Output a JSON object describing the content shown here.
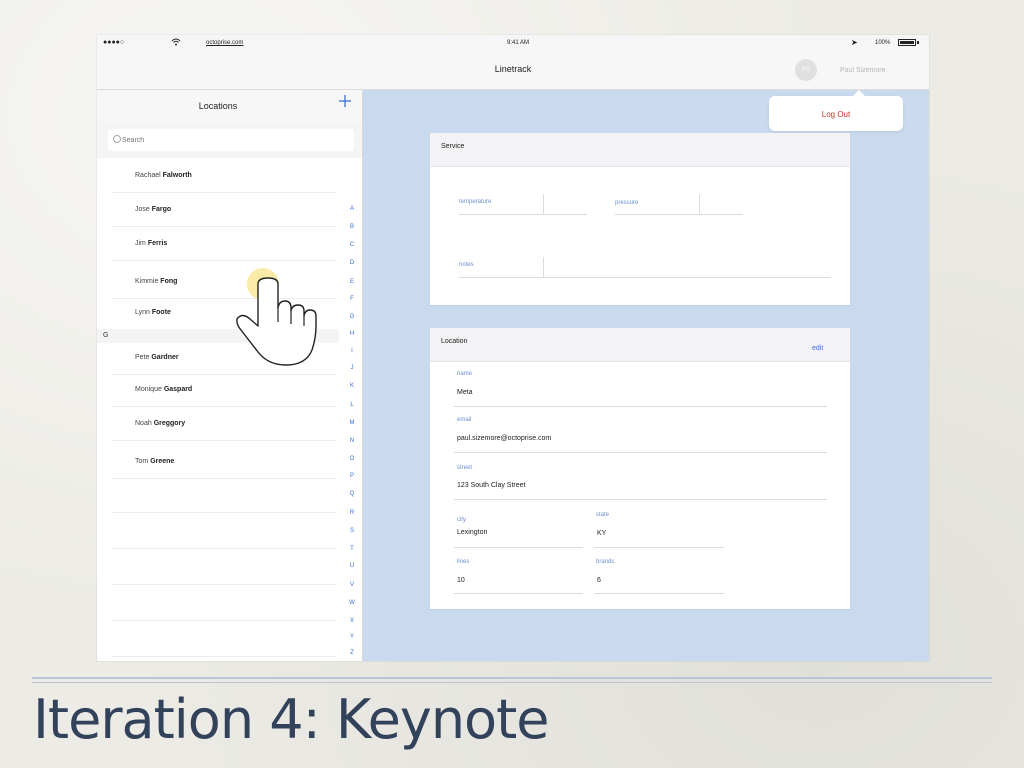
{
  "status_bar": {
    "url": "octoprise.com",
    "time": "9:41 AM",
    "battery_pct": "100%"
  },
  "nav": {
    "title": "Linetrack",
    "avatar_initials": "PS",
    "user_name": "Paul Sizemore"
  },
  "popover": {
    "logout_label": "Log Out"
  },
  "locations_panel": {
    "title": "Locations",
    "add_icon": "plus-icon",
    "search_placeholder": "Search",
    "section_header": "G",
    "contacts": [
      {
        "first": "Rachael",
        "last": "Falworth"
      },
      {
        "first": "Jose",
        "last": "Fargo"
      },
      {
        "first": "Jim",
        "last": "Ferris"
      },
      {
        "first": "Kimmie",
        "last": "Fong"
      },
      {
        "first": "Lynn",
        "last": "Foote"
      },
      {
        "first": "Pete",
        "last": "Gardner"
      },
      {
        "first": "Monique",
        "last": "Gaspard"
      },
      {
        "first": "Noah",
        "last": "Greggory"
      },
      {
        "first": "Tom",
        "last": "Greene"
      }
    ],
    "index_letters": [
      "A",
      "B",
      "C",
      "D",
      "E",
      "F",
      "G",
      "H",
      "I",
      "J",
      "K",
      "L",
      "M",
      "N",
      "O",
      "P",
      "Q",
      "R",
      "S",
      "T",
      "U",
      "V",
      "W",
      "X",
      "Y",
      "Z",
      "#"
    ]
  },
  "service_card": {
    "title": "Service",
    "temperature_label": "temperature",
    "pressure_label": "pressure",
    "notes_label": "notes"
  },
  "location_card": {
    "title": "Location",
    "edit_label": "edit",
    "name_label": "name",
    "name_value": "Meta",
    "email_label": "email",
    "email_value": "paul.sizemore@octoprise.com",
    "street_label": "street",
    "street_value": "123 South Clay Street",
    "city_label": "city",
    "city_value": "Lexington",
    "state_label": "state",
    "state_value": "KY",
    "lines_label": "lines",
    "lines_value": "10",
    "brands_label": "brands",
    "brands_value": "6"
  },
  "slide_caption": "Iteration 4: Keynote",
  "colors": {
    "accent": "#3b6fd6",
    "logout": "#c0392b",
    "content_bg": "#c9d9ee",
    "caption": "#33425b",
    "touch_highlight": "#fbe9a0"
  }
}
